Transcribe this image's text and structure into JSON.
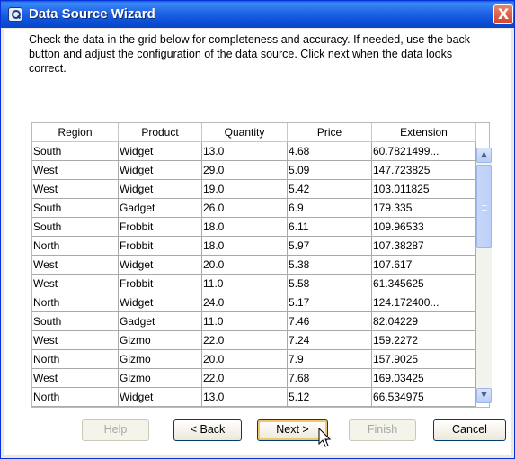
{
  "window": {
    "title": "Data Source Wizard",
    "close_label": "X"
  },
  "instructions": "Check the data in the grid below for completeness and accuracy.  If needed, use the back button and adjust the configuration of the data source.  Click next when the data looks correct.",
  "grid": {
    "columns": [
      "Region",
      "Product",
      "Quantity",
      "Price",
      "Extension"
    ],
    "rows": [
      [
        "South",
        "Widget",
        "13.0",
        "4.68",
        "60.7821499..."
      ],
      [
        "West",
        "Widget",
        "29.0",
        "5.09",
        "147.723825"
      ],
      [
        "West",
        "Widget",
        "19.0",
        "5.42",
        "103.011825"
      ],
      [
        "South",
        "Gadget",
        "26.0",
        "6.9",
        "179.335"
      ],
      [
        "South",
        "Frobbit",
        "18.0",
        "6.11",
        "109.96533"
      ],
      [
        "North",
        "Frobbit",
        "18.0",
        "5.97",
        "107.38287"
      ],
      [
        "West",
        "Widget",
        "20.0",
        "5.38",
        "107.617"
      ],
      [
        "West",
        "Frobbit",
        "11.0",
        "5.58",
        "61.345625"
      ],
      [
        "North",
        "Widget",
        "24.0",
        "5.17",
        "124.172400..."
      ],
      [
        "South",
        "Gadget",
        "11.0",
        "7.46",
        "82.04229"
      ],
      [
        "West",
        "Gizmo",
        "22.0",
        "7.24",
        "159.2272"
      ],
      [
        "North",
        "Gizmo",
        "20.0",
        "7.9",
        "157.9025"
      ],
      [
        "West",
        "Gizmo",
        "22.0",
        "7.68",
        "169.03425"
      ],
      [
        "North",
        "Widget",
        "13.0",
        "5.12",
        "66.534975"
      ]
    ]
  },
  "scrollbar": {
    "up_icon": "chevron-up-icon",
    "down_icon": "chevron-down-icon"
  },
  "buttons": {
    "help": "Help",
    "back": "< Back",
    "next": "Next >",
    "finish": "Finish",
    "cancel": "Cancel"
  },
  "colors": {
    "title_bar": "#2366e6",
    "close_button": "#d1452a",
    "window_bg": "#ece9d8"
  }
}
